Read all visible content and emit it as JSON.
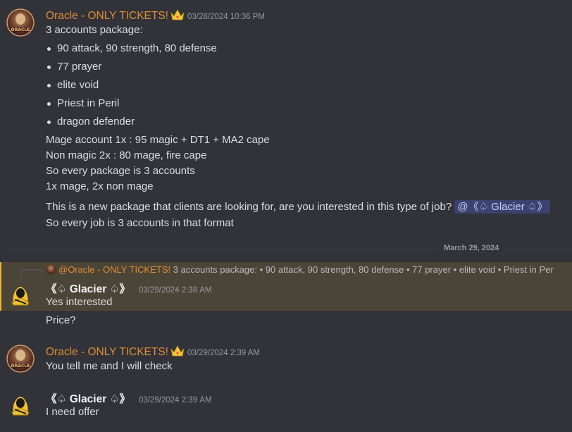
{
  "messages": [
    {
      "author": "Oracle - ONLY TICKETS!",
      "timestamp": "03/28/2024 10:36 PM",
      "intro": "3 accounts package:",
      "bullets": [
        "90 attack, 90 strength, 80 defense",
        "77 prayer",
        "elite void",
        "Priest in Peril",
        "dragon defender"
      ],
      "lines": [
        "Mage account 1x : 95 magic + DT1 + MA2 cape",
        "Non magic 2x : 80 mage, fire cape",
        "So every package is 3 accounts",
        "1x mage, 2x non mage"
      ],
      "question": "This is a new package that clients are looking for, are you interested in this type of job?",
      "mention": "@《♤ Glacier ♤》",
      "closing": "So every job is 3 accounts in that format"
    }
  ],
  "divider_date": "March 29, 2024",
  "reply_preview": {
    "mention": "@Oracle - ONLY TICKETS!",
    "text": "3 accounts package:  • 90 attack, 90 strength, 80 defense  • 77 prayer  • elite void  • Priest in Per"
  },
  "glacier_msg_1": {
    "author": "《♤ Glacier ♤》",
    "timestamp": "03/29/2024 2:38 AM",
    "line1": "Yes interested",
    "line2": "Price?"
  },
  "oracle_msg_2": {
    "author": "Oracle - ONLY TICKETS!",
    "timestamp": "03/29/2024 2:39 AM",
    "line1": "You tell me and I will check"
  },
  "glacier_msg_2": {
    "author": "《♤ Glacier ♤》",
    "timestamp": "03/29/2024 2:39 AM",
    "line1": "I need offer"
  },
  "colors": {
    "background": "#313338",
    "oracle_name": "#e08c3a",
    "mention_bg": "#3c4270",
    "highlight_bg": "#4a4536",
    "highlight_bar": "#f0b232"
  },
  "icons": [
    "crown-icon",
    "oracle-avatar",
    "glacier-avatar"
  ]
}
